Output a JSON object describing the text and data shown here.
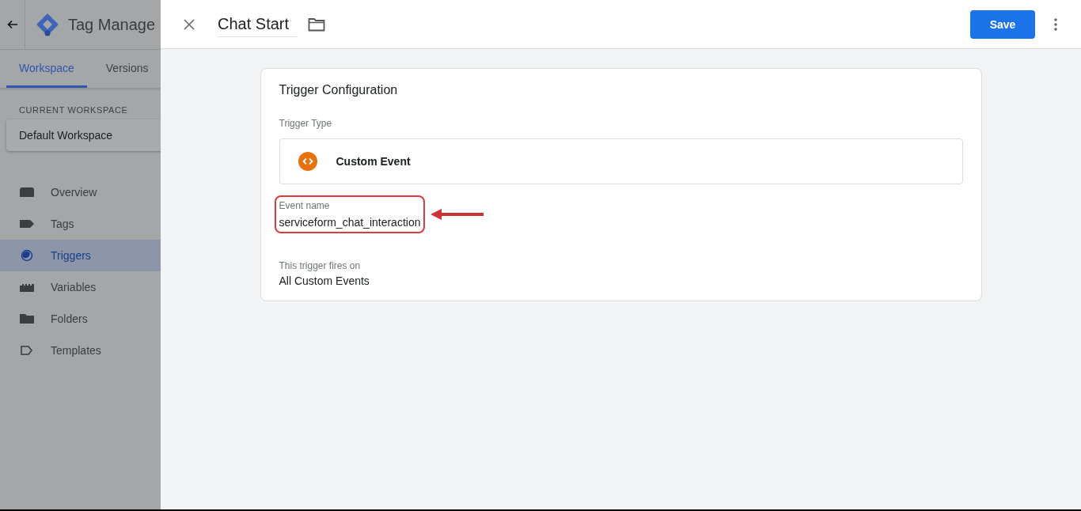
{
  "app": {
    "title": "Tag Manage"
  },
  "tabs": [
    {
      "label": "Workspace",
      "selected": true
    },
    {
      "label": "Versions",
      "selected": false
    }
  ],
  "workspace": {
    "heading": "CURRENT WORKSPACE",
    "name": "Default Workspace"
  },
  "sidebar": {
    "items": [
      {
        "label": "Overview",
        "kind": "overview",
        "selected": false
      },
      {
        "label": "Tags",
        "kind": "tags",
        "selected": false
      },
      {
        "label": "Triggers",
        "kind": "triggers",
        "selected": true
      },
      {
        "label": "Variables",
        "kind": "variables",
        "selected": false
      },
      {
        "label": "Folders",
        "kind": "folders",
        "selected": false
      },
      {
        "label": "Templates",
        "kind": "templates",
        "selected": false
      }
    ]
  },
  "editor": {
    "title": "Chat Start",
    "save": "Save"
  },
  "card": {
    "title": "Trigger Configuration",
    "type_label": "Trigger Type",
    "type": "Custom Event",
    "event_label": "Event name",
    "event_value": "serviceform_chat_interaction",
    "fires_label": "This trigger fires on",
    "fires_value": "All Custom Events"
  }
}
